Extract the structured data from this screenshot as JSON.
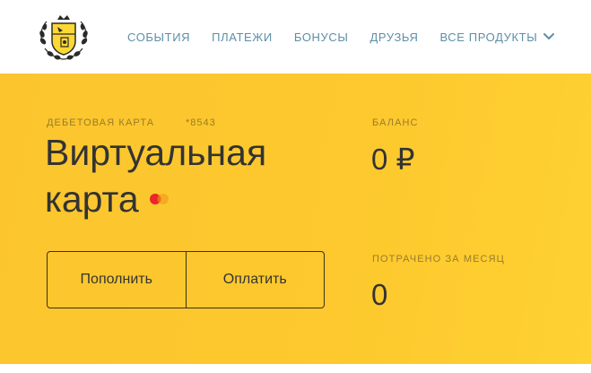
{
  "nav": {
    "items": [
      {
        "label": "СОБЫТИЯ"
      },
      {
        "label": "ПЛАТЕЖИ"
      },
      {
        "label": "БОНУСЫ"
      },
      {
        "label": "ДРУЗЬЯ"
      },
      {
        "label": "ВСЕ ПРОДУКТЫ"
      }
    ]
  },
  "card": {
    "type_label": "ДЕБЕТОВАЯ КАРТА",
    "number": "*8543",
    "name": "Виртуальная карта",
    "payment_system_icon": "mastercard-icon"
  },
  "actions": {
    "topup_label": "Пополнить",
    "pay_label": "Оплатить"
  },
  "balance": {
    "label": "БАЛАНС",
    "value": "0 ₽"
  },
  "spent": {
    "label": "ПОТРАЧЕНО ЗА МЕСЯЦ",
    "value": "0"
  },
  "colors": {
    "accent_yellow": "#fdc92e",
    "nav_text": "#5d8fa8",
    "text_dark": "#333333"
  }
}
